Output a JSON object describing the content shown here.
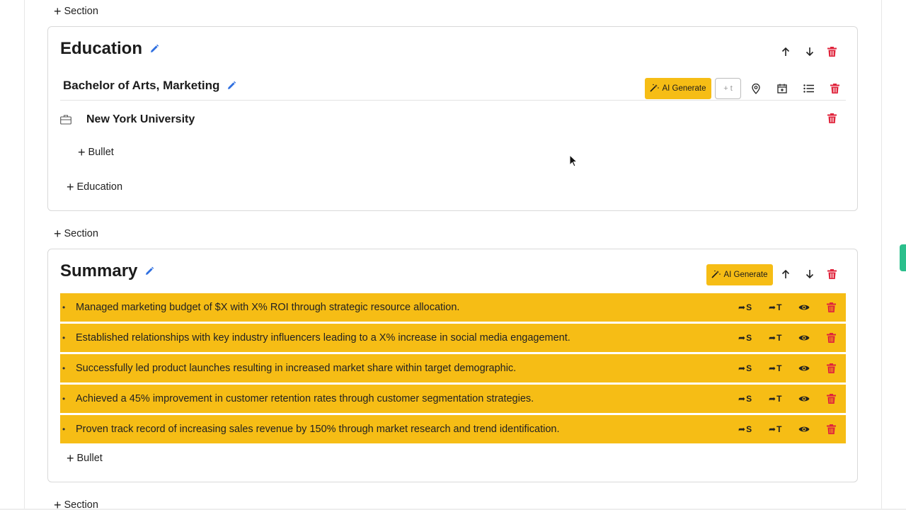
{
  "add_section_label": "Section",
  "education": {
    "title": "Education",
    "degree": "Bachelor of Arts, Marketing",
    "ai_generate_label": "AI Generate",
    "plus_t_label": "+ t",
    "school": "New York University",
    "add_bullet_label": "Bullet",
    "add_education_label": "Education"
  },
  "summary": {
    "title": "Summary",
    "ai_generate_label": "AI Generate",
    "bullets": [
      "Managed marketing budget of $X with X% ROI through strategic resource allocation.",
      "Established relationships with key industry influencers leading to a X% increase in social media engagement.",
      "Successfully led product launches resulting in increased market share within target demographic.",
      "Achieved a 45% improvement in customer retention rates through customer segmentation strategies.",
      "Proven track record of increasing sales revenue by 150% through market research and trend identification."
    ],
    "row_action_s_label": "S",
    "row_action_t_label": "T",
    "add_bullet_label": "Bullet"
  },
  "icons": {
    "edit": "pencil-icon",
    "up": "arrow-up-icon",
    "down": "arrow-down-icon",
    "delete": "trash-icon",
    "location": "map-pin-icon",
    "date": "calendar-icon",
    "list": "list-icon",
    "school": "briefcase-icon",
    "visibility": "eye-icon",
    "share": "share-icon"
  },
  "colors": {
    "accent": "#f6bd15",
    "danger": "#e0243c",
    "link": "#2f6fe0",
    "side_tab": "#2bbf8c"
  }
}
